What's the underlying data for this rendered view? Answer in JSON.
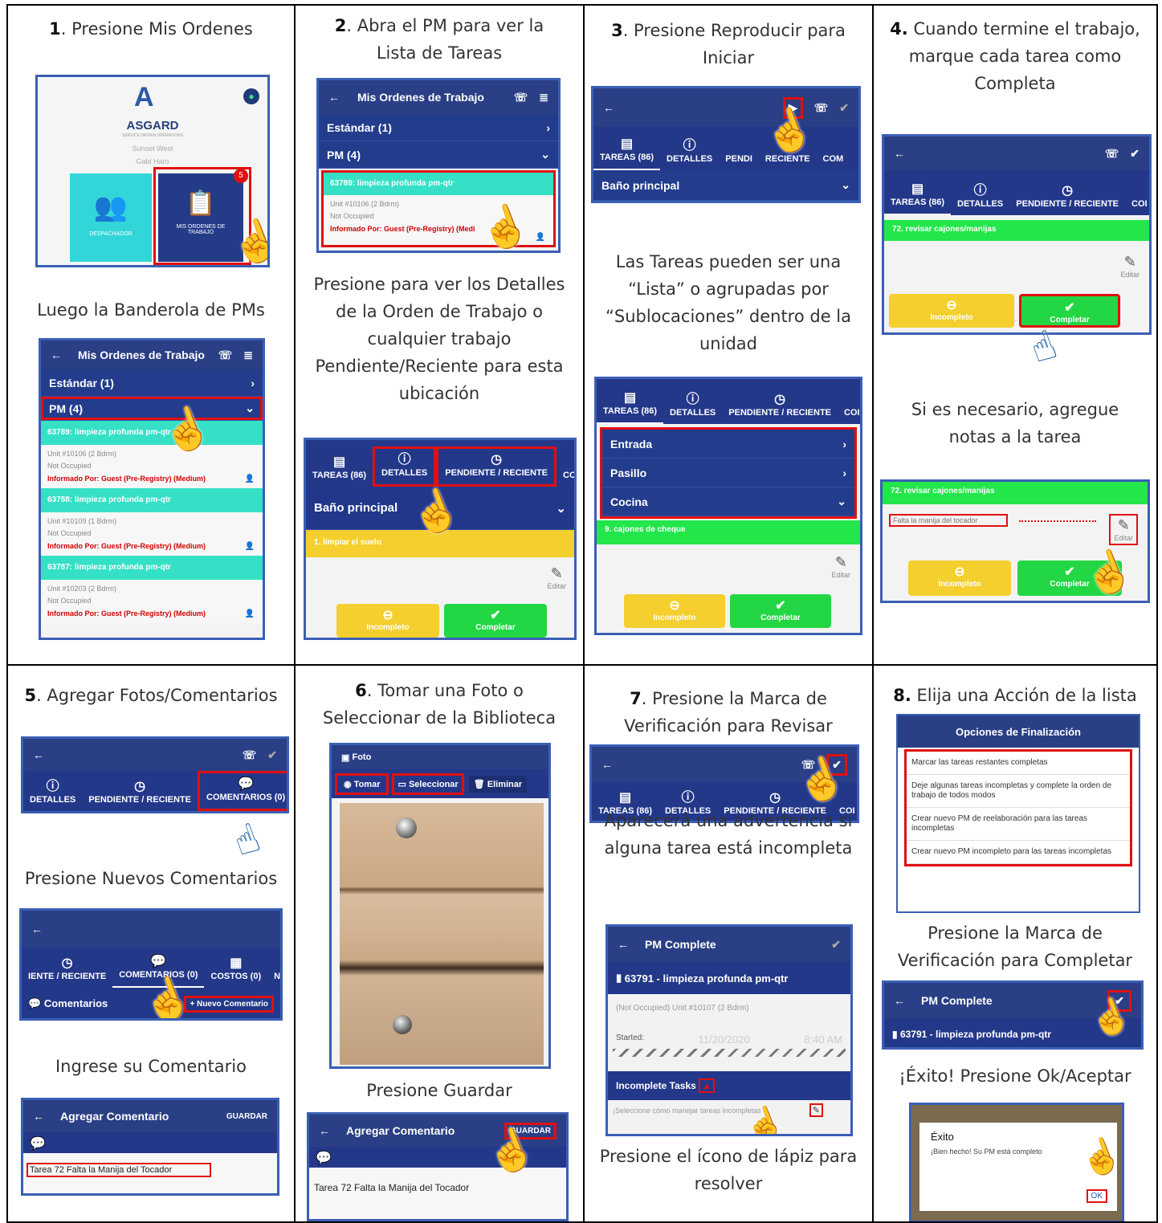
{
  "c1": {
    "num": "1",
    "text": ". Presione Mis Ordenes",
    "cap2": "Luego la Banderola de PMs",
    "logo": "ASGARD",
    "tagline": "SERVICE DRIVEN OPERATIONS",
    "prop": "Sunset West",
    "user": "Gabi Haro",
    "badge": "5",
    "tile1": "DESPACHADOR",
    "tile2a": "MIS ORDENES DE",
    "tile2b": "TRABAJO",
    "title": "Mis Ordenes de Trabajo",
    "std": "Estándar (1)",
    "pm": "PM (4)",
    "items": [
      {
        "head": "63789: limpieza profunda pm-qtr",
        "unit": "Unit #10106 (2 Bdrm)",
        "occ": "Not Occupied",
        "inf": "Informado Por: Guest (Pre-Registry) (Medium)"
      },
      {
        "head": "63788: limpieza profunda pm-qtr",
        "unit": "Unit #10109 (1 Bdrm)",
        "occ": "Not Occupied",
        "inf": "Informado Por: Guest (Pre-Registry) (Medium)"
      },
      {
        "head": "63787: limpieza profunda pm-qtr",
        "unit": "Unit #10203 (2 Bdrm)",
        "occ": "Not Occupied",
        "inf": "Informado Por: Guest (Pre-Registry) (Medium)"
      }
    ]
  },
  "c2": {
    "num": "2",
    "l1": ". Abra el PM para ver la",
    "l2": "Lista de Tareas",
    "title": "Mis Ordenes de Trabajo",
    "std": "Estándar (1)",
    "pm": "PM (4)",
    "head": "63789: limpieza profunda pm-qtr",
    "unit": "Unit #10106 (2 Bdrm)",
    "occ": "Not Occupied",
    "inf": "Informado Por: Guest (Pre-Registry) (Medi",
    "cap": [
      "Presione para ver los Detalles",
      "de la Orden de Trabajo o",
      "cualquier trabajo",
      "Pendiente/Reciente para esta",
      "ubicación"
    ],
    "tabs": [
      "TAREAS (86)",
      "DETALLES",
      "PENDIENTE / RECIENTE",
      "COM"
    ],
    "group": "Baño principal",
    "task": "1.  limpiar el suelo",
    "edit": "Editar",
    "inc": "Incompleto",
    "comp": "Completar"
  },
  "c3": {
    "num": "3",
    "l1": ". Presione Reproducir para",
    "l2": "Iniciar",
    "tabs": [
      "TAREAS (86)",
      "DETALLES",
      "PENDI",
      "RECIENTE",
      "COM"
    ],
    "group": "Baño principal",
    "cap": [
      "Las Tareas pueden ser una",
      "“Lista” o agrupadas por",
      "“Sublocaciones” dentro de la",
      "unidad"
    ],
    "tabs2": [
      "TAREAS (86)",
      "DETALLES",
      "PENDIENTE / RECIENTE",
      "COI"
    ],
    "rows": [
      "Entrada",
      "Pasillo",
      "Cocina"
    ],
    "task": "9.  cajones de cheque",
    "edit": "Editar",
    "inc": "Incompleto",
    "comp": "Completar"
  },
  "c4": {
    "num": "4.",
    "l1": " Cuando termine el trabajo,",
    "l2": "marque cada tarea como",
    "l3": "Completa",
    "tabs": [
      "TAREAS (86)",
      "DETALLES",
      "PENDIENTE / RECIENTE",
      "COI"
    ],
    "task": "72.  revisar cajones/manijas",
    "edit": "Editar",
    "inc": "Incompleto",
    "comp": "Completar",
    "cap": [
      "Si es necesario, agregue",
      "notas a la tarea"
    ],
    "note": "Falta la manija del tocador"
  },
  "c5": {
    "num": "5",
    "l1": ". Agregar Fotos/Comentarios",
    "tabs": [
      "DETALLES",
      "PENDIENTE / RECIENTE",
      "COMENTARIOS (0)"
    ],
    "cap2": "Presione Nuevos Comentarios",
    "tabs2": [
      "IENTE / RECIENTE",
      "COMENTARIOS (0)",
      "COSTOS (0)",
      "NO"
    ],
    "comentarios": "Comentarios",
    "nuevo": "Nuevo Comentario",
    "cap3": "Ingrese su Comentario",
    "bar": "Agregar Comentario",
    "save": "GUARDAR",
    "text": "Tarea 72 Falta la Manija del Tocador"
  },
  "c6": {
    "num": "6",
    "l1": ". Tomar una Foto o",
    "l2": "Seleccionar de la Biblioteca",
    "foto": "Foto",
    "tomar": "Tomar",
    "sel": "Seleccionar",
    "elim": "Eliminar",
    "cap2": "Presione Guardar",
    "bar": "Agregar Comentario",
    "save": "GUARDAR",
    "text": "Tarea 72 Falta la Manija del Tocador"
  },
  "c7": {
    "num": "7",
    "l1": ". Presione la Marca de",
    "l2": "Verificación para Revisar",
    "tabs": [
      "TAREAS (86)",
      "DETALLES",
      "PENDIENTE / RECIENTE",
      "COI"
    ],
    "cap": [
      "Aparecerá una advertencia si",
      "alguna tarea está incompleta"
    ],
    "pmc": "PM Complete",
    "wo": "63791 - limpieza profunda pm-qtr",
    "unit": "(Not Occupied) Unit #10107 (2 Bdrm)",
    "started": "Started:",
    "date": "11/20/2020",
    "time": "8:40 AM",
    "inc": "Incomplete Tasks",
    "sel": "¡Seleccione cómo manejar tareas incompletas",
    "cap3": [
      "Presione el ícono de lápiz para",
      "resolver"
    ]
  },
  "c8": {
    "num": "8.",
    "l1": " Elija una Acción de la lista",
    "opts": "Opciones de Finalización",
    "list": [
      "Marcar las tareas restantes completas",
      "Deje algunas tareas incompletas y complete la orden de trabajo de todos modos",
      "Crear nuevo PM de reelaboración para las tareas incompletas",
      "Crear nuevo PM incompleto para las tareas incompletas"
    ],
    "cap2": [
      "Presione la Marca de",
      "Verificación para Completar"
    ],
    "pmc": "PM Complete",
    "wo": "63791 - limpieza profunda pm-qtr",
    "cap3": "¡Éxito! Presione Ok/Aceptar",
    "exito": "Éxito",
    "msg": "¡Bien hecho! Su PM está completo",
    "ok": "OK"
  }
}
